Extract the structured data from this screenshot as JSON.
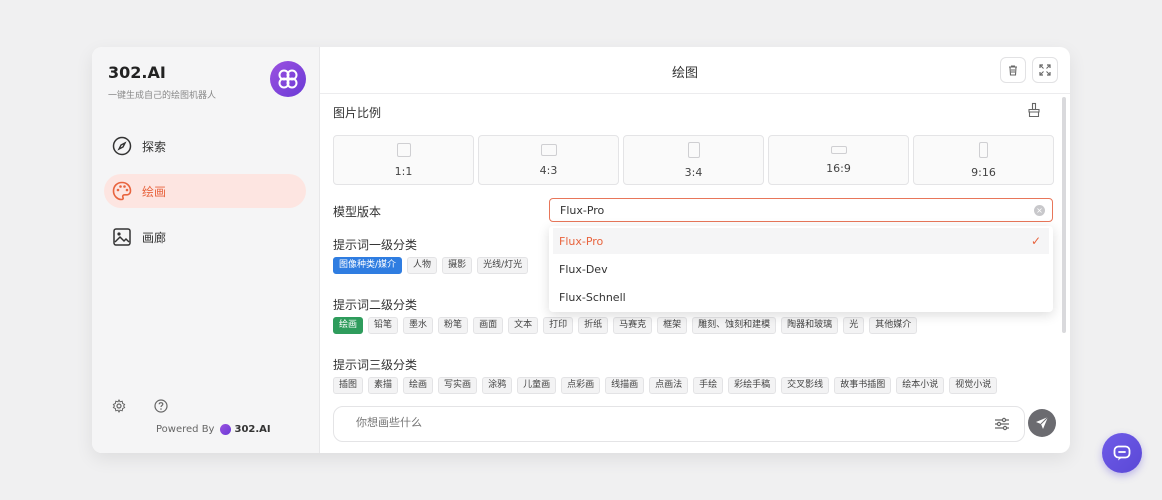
{
  "sidebar": {
    "brand_title": "302.AI",
    "brand_subtitle": "一键生成自己的绘图机器人",
    "items": [
      {
        "label": "探索",
        "icon": "compass-icon"
      },
      {
        "label": "绘画",
        "icon": "palette-icon",
        "active": true
      },
      {
        "label": "画廊",
        "icon": "image-icon"
      }
    ],
    "footer_icons": [
      "gear-icon",
      "help-icon"
    ],
    "powered_prefix": "Powered By",
    "powered_brand": "302.AI"
  },
  "main": {
    "title": "绘图",
    "aspect": {
      "label": "图片比例",
      "options": [
        "1:1",
        "4:3",
        "3:4",
        "16:9",
        "9:16"
      ]
    },
    "model": {
      "label": "模型版本",
      "value": "Flux-Pro",
      "options": [
        "Flux-Pro",
        "Flux-Dev",
        "Flux-Schnell"
      ],
      "selected_index": 0
    },
    "prompt_level1": {
      "label": "提示词一级分类",
      "tags": [
        "图像种类/媒介",
        "人物",
        "摄影",
        "光线/灯光"
      ]
    },
    "prompt_level2": {
      "label": "提示词二级分类",
      "tags": [
        "绘画",
        "铅笔",
        "墨水",
        "粉笔",
        "画面",
        "文本",
        "打印",
        "折纸",
        "马赛克",
        "框架",
        "雕刻、蚀刻和建模",
        "陶器和玻璃",
        "光",
        "其他媒介"
      ]
    },
    "prompt_level3": {
      "label": "提示词三级分类",
      "tags": [
        "插图",
        "素描",
        "绘画",
        "写实画",
        "涂鸦",
        "儿童画",
        "点彩画",
        "线描画",
        "点画法",
        "手绘",
        "彩绘手稿",
        "交叉影线",
        "故事书插图",
        "绘本小说",
        "视觉小说"
      ]
    },
    "input_placeholder": "你想画些什么"
  },
  "colors": {
    "accent": "#e8643e",
    "brand_purple": "#7b45dd",
    "tag_blue": "#2f7de1",
    "tag_green": "#2e9c5c"
  }
}
